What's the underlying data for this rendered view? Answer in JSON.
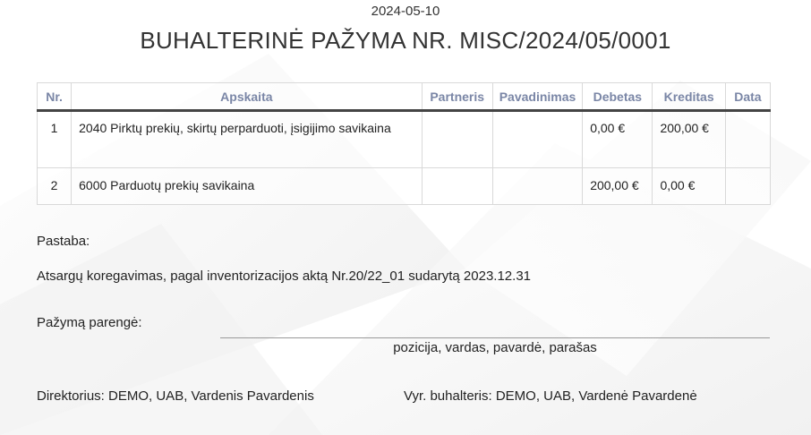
{
  "date": "2024-05-10",
  "title": "BUHALTERINĖ PAŽYMA NR. MISC/2024/05/0001",
  "table": {
    "headers": [
      "Nr.",
      "Apskaita",
      "Partneris",
      "Pavadinimas",
      "Debetas",
      "Kreditas",
      "Data"
    ],
    "rows": [
      {
        "nr": "1",
        "apskaita": "2040 Pirktų prekių, skirtų perparduoti, įsigijimo savikaina",
        "partneris": "",
        "pavadinimas": "",
        "debetas": "0,00 €",
        "kreditas": "200,00 €",
        "data": ""
      },
      {
        "nr": "2",
        "apskaita": "6000 Parduotų prekių savikaina",
        "partneris": "",
        "pavadinimas": "",
        "debetas": "200,00 €",
        "kreditas": "0,00 €",
        "data": ""
      }
    ]
  },
  "note_label": "Pastaba:",
  "note_text": "Atsargų koregavimas, pagal inventorizacijos aktą Nr.20/22_01 sudarytą 2023.12.31",
  "prepared_label": "Pažymą parengė:",
  "signature_caption": "pozicija, vardas, pavardė, parašas",
  "director": "Direktorius: DEMO, UAB, Vardenis Pavardenis",
  "chief_accountant": "Vyr. buhalteris: DEMO, UAB, Vardenė Pavardenė"
}
